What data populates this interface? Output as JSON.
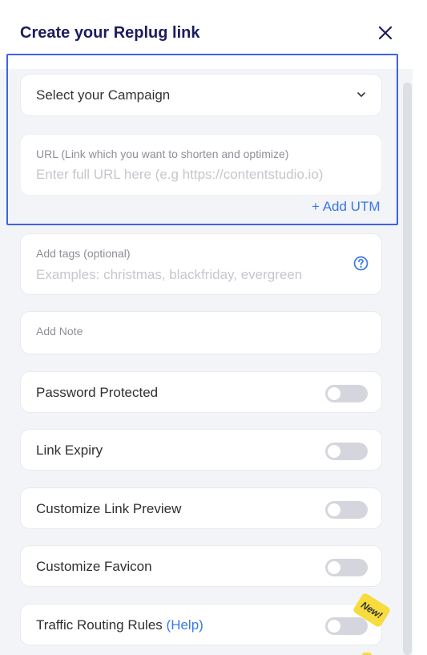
{
  "header": {
    "title": "Create your Replug link"
  },
  "campaign_select": {
    "selected": "Select your Campaign"
  },
  "url_field": {
    "label": "URL (Link which you want to shorten and optimize)",
    "value": "",
    "placeholder": "Enter full URL here (e.g https://contentstudio.io)"
  },
  "add_utm": {
    "label": "+ Add UTM"
  },
  "tags_field": {
    "label": "Add tags (optional)",
    "value": "",
    "placeholder": "Examples: christmas, blackfriday, evergreen"
  },
  "note_field": {
    "label": "Add Note"
  },
  "toggles": [
    {
      "label": "Password Protected",
      "enabled": false
    },
    {
      "label": "Link Expiry",
      "enabled": false
    },
    {
      "label": "Customize Link Preview",
      "enabled": false
    },
    {
      "label": "Customize Favicon",
      "enabled": false
    },
    {
      "label": "Traffic Routing Rules",
      "help": "(Help)",
      "badge": "New!",
      "enabled": false
    }
  ],
  "colors": {
    "title": "#1c1d5c",
    "accent": "#3a78e6",
    "highlight": "#3d63e6",
    "badge": "#f6dc3c"
  },
  "icons": {
    "close": "close-icon",
    "dropdown": "chevron-down-icon",
    "help": "question-circle-icon"
  }
}
